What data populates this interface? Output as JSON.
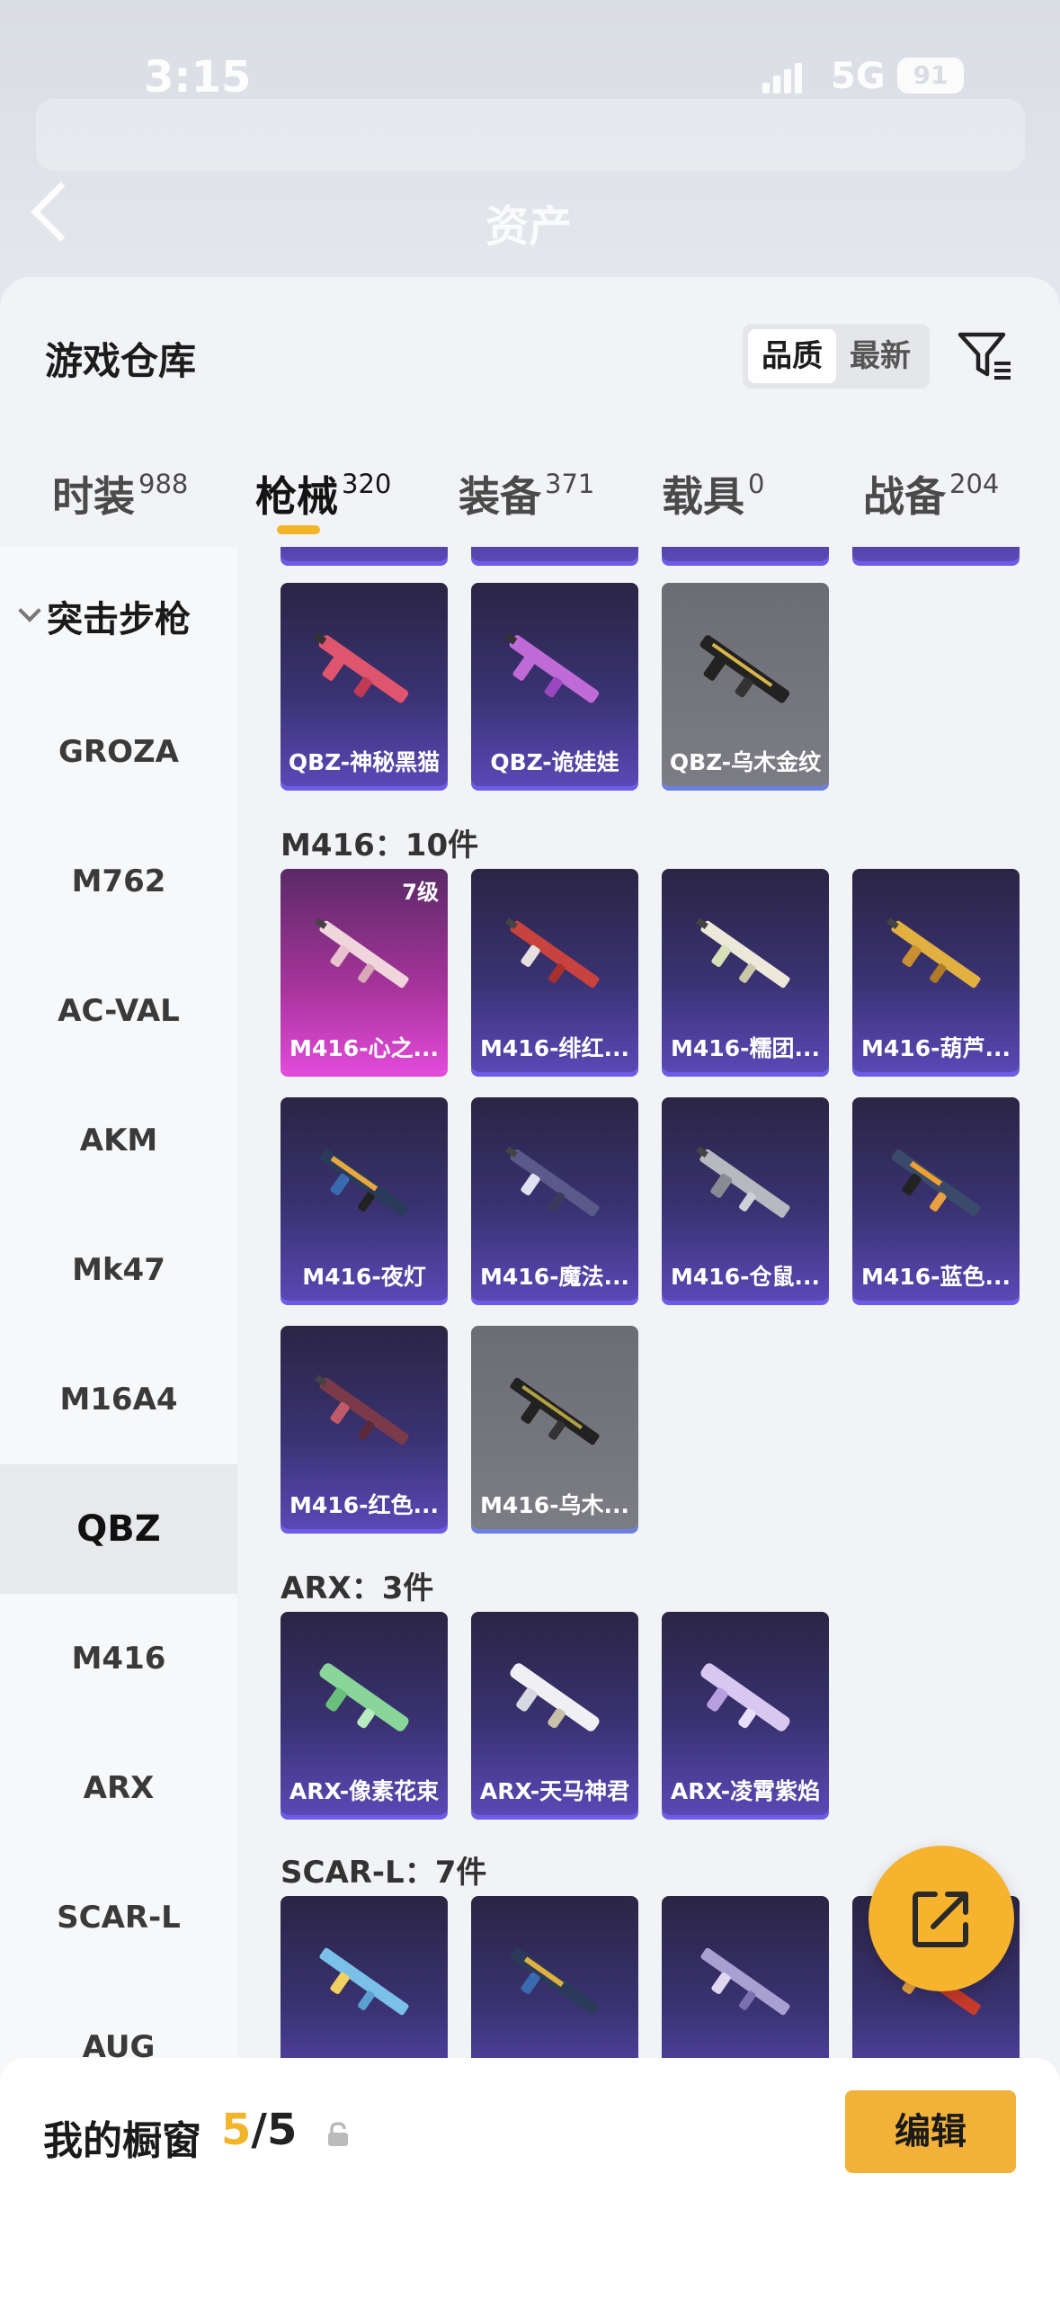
{
  "status": {
    "time": "3:15",
    "network": "5G",
    "battery": "91"
  },
  "header": {
    "title": "资产"
  },
  "sheet": {
    "title": "游戏仓库",
    "sort": {
      "active": "品质",
      "inactive": "最新"
    }
  },
  "tabs": [
    {
      "label": "时装",
      "count": "988"
    },
    {
      "label": "枪械",
      "count": "320"
    },
    {
      "label": "装备",
      "count": "371"
    },
    {
      "label": "载具",
      "count": "0"
    },
    {
      "label": "战备",
      "count": "204"
    }
  ],
  "sidebar": {
    "group": "突击步枪",
    "items": [
      "GROZA",
      "M762",
      "AC-VAL",
      "AKM",
      "Mk47",
      "M16A4",
      "QBZ",
      "M416",
      "ARX",
      "SCAR-L",
      "AUG"
    ]
  },
  "sections": {
    "qbz": {
      "cards": [
        "QBZ-神秘黑猫",
        "QBZ-诡娃娃",
        "QBZ-乌木金纹"
      ]
    },
    "m416": {
      "title": "M416：10件",
      "cards": [
        "M416-心之...",
        "M416-绯红...",
        "M416-糯团...",
        "M416-葫芦...",
        "M416-夜灯",
        "M416-魔法...",
        "M416-仓鼠...",
        "M416-蓝色...",
        "M416-红色...",
        "M416-乌木..."
      ],
      "level_badge": "7级"
    },
    "arx": {
      "title": "ARX：3件",
      "cards": [
        "ARX-像素花束",
        "ARX-天马神君",
        "ARX-凌霄紫焰"
      ]
    },
    "scarl": {
      "title": "SCAR-L：7件"
    }
  },
  "showcase": {
    "title": "我的橱窗",
    "current": "5",
    "total": "/5",
    "edit_label": "编辑"
  },
  "colors": {
    "accent": "#f2b52a",
    "card_purple": "#3a3272",
    "card_gray": "#7c7c84",
    "card_pink": "#e04ad8"
  },
  "icons": [
    "back-icon",
    "filter-icon",
    "chevron-down-icon",
    "lock-icon",
    "share-icon",
    "rifle-icon"
  ]
}
